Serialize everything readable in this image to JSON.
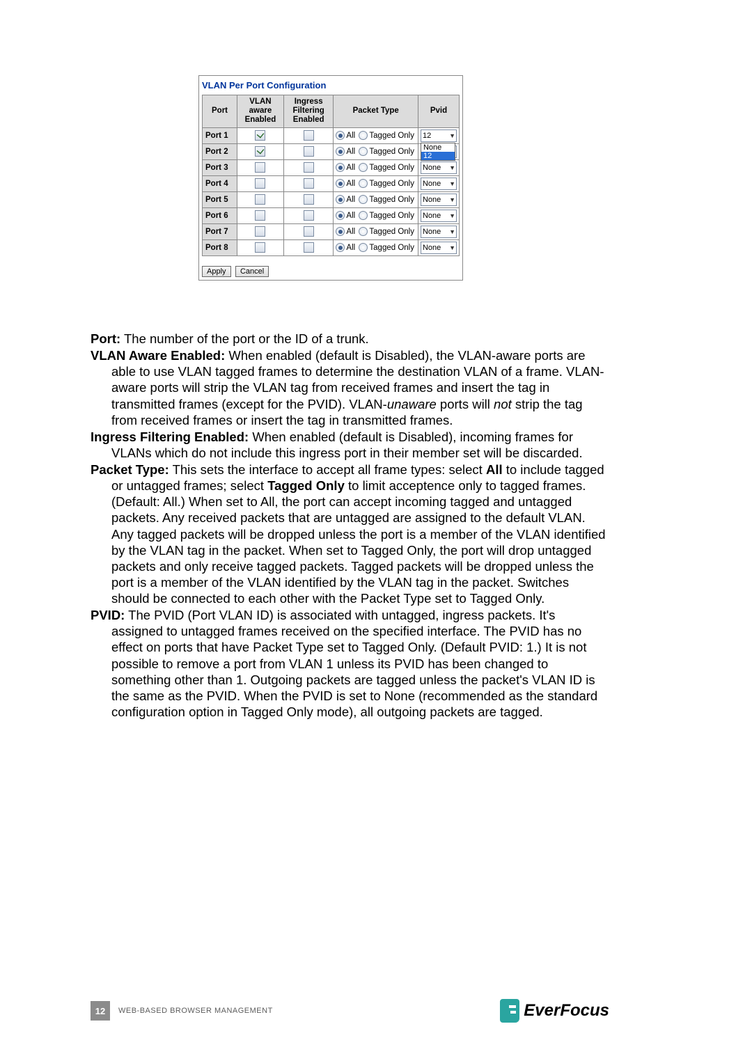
{
  "screenshot": {
    "title": "VLAN Per Port Configuration",
    "headers": {
      "port": "Port",
      "aware": "VLAN aware Enabled",
      "ingress": "Ingress Filtering Enabled",
      "ptype": "Packet Type",
      "pvid": "Pvid"
    },
    "labels": {
      "all": "All",
      "tagged": "Tagged Only"
    },
    "rows": [
      {
        "port": "Port 1",
        "aware": true,
        "ingress": false,
        "pvid": "12",
        "open": true
      },
      {
        "port": "Port 2",
        "aware": true,
        "ingress": false,
        "pvid": "None"
      },
      {
        "port": "Port 3",
        "aware": false,
        "ingress": false,
        "pvid": "None"
      },
      {
        "port": "Port 4",
        "aware": false,
        "ingress": false,
        "pvid": "None"
      },
      {
        "port": "Port 5",
        "aware": false,
        "ingress": false,
        "pvid": "None"
      },
      {
        "port": "Port 6",
        "aware": false,
        "ingress": false,
        "pvid": "None"
      },
      {
        "port": "Port 7",
        "aware": false,
        "ingress": false,
        "pvid": "None"
      },
      {
        "port": "Port 8",
        "aware": false,
        "ingress": false,
        "pvid": "None"
      }
    ],
    "dropdown": {
      "opt1": "None",
      "opt2": "12"
    },
    "buttons": {
      "apply": "Apply",
      "cancel": "Cancel"
    }
  },
  "defs": {
    "port": {
      "term": "Port:",
      "text": " The number of the port or the ID of a trunk."
    },
    "aware": {
      "term": "VLAN Aware Enabled:",
      "text": " When enabled (default is Disabled), the VLAN-aware ports are able to use VLAN tagged frames to determine the destination VLAN of a frame. VLAN-aware ports will strip the VLAN tag from received frames and insert the tag in transmitted frames (except for the PVID). VLAN-",
      "em": "unaware",
      "text2": " ports will ",
      "em2": "not",
      "text3": " strip the tag from received frames or insert the tag in transmitted frames."
    },
    "ingress": {
      "term": "Ingress Filtering Enabled:",
      "text": " When enabled (default is Disabled), incoming frames for VLANs which do not include this ingress port in their member set will be discarded."
    },
    "ptype": {
      "term": "Packet Type:",
      "t1": " This sets the interface to accept all frame types: select ",
      "b1": "All",
      "t2": " to include tagged or untagged frames; select ",
      "b2": "Tagged Only",
      "t3": " to limit acceptence only to tagged frames. (Default: All.) When set to All, the port can accept incoming tagged and untagged packets. Any received packets that are untagged are assigned to the default VLAN. Any tagged packets will be dropped unless the port is a member of the VLAN identified by the VLAN tag in the packet. When set to Tagged Only, the port will drop untagged packets and only receive tagged packets. Tagged packets will be dropped unless the port is a member of the VLAN identified by the VLAN tag in the packet. Switches should be connected to each other with the Packet Type set to Tagged Only."
    },
    "pvid": {
      "term": "PVID:",
      "text": " The PVID (Port VLAN ID) is associated with untagged, ingress packets. It's assigned to untagged frames received on the specified interface. The PVID has no effect on ports that have Packet Type set to Tagged Only. (Default PVID: 1.) It is not possible to remove a port from VLAN 1 unless its PVID has been changed to something other than 1. Outgoing packets are tagged unless the packet's VLAN ID is the same as the PVID. When the PVID is set to None (recommended as the standard configuration option in Tagged Only mode), all outgoing packets are tagged."
    }
  },
  "footer": {
    "page": "12",
    "label": "WEB-BASED BROWSER MANAGEMENT",
    "brand": "EverFocus"
  }
}
